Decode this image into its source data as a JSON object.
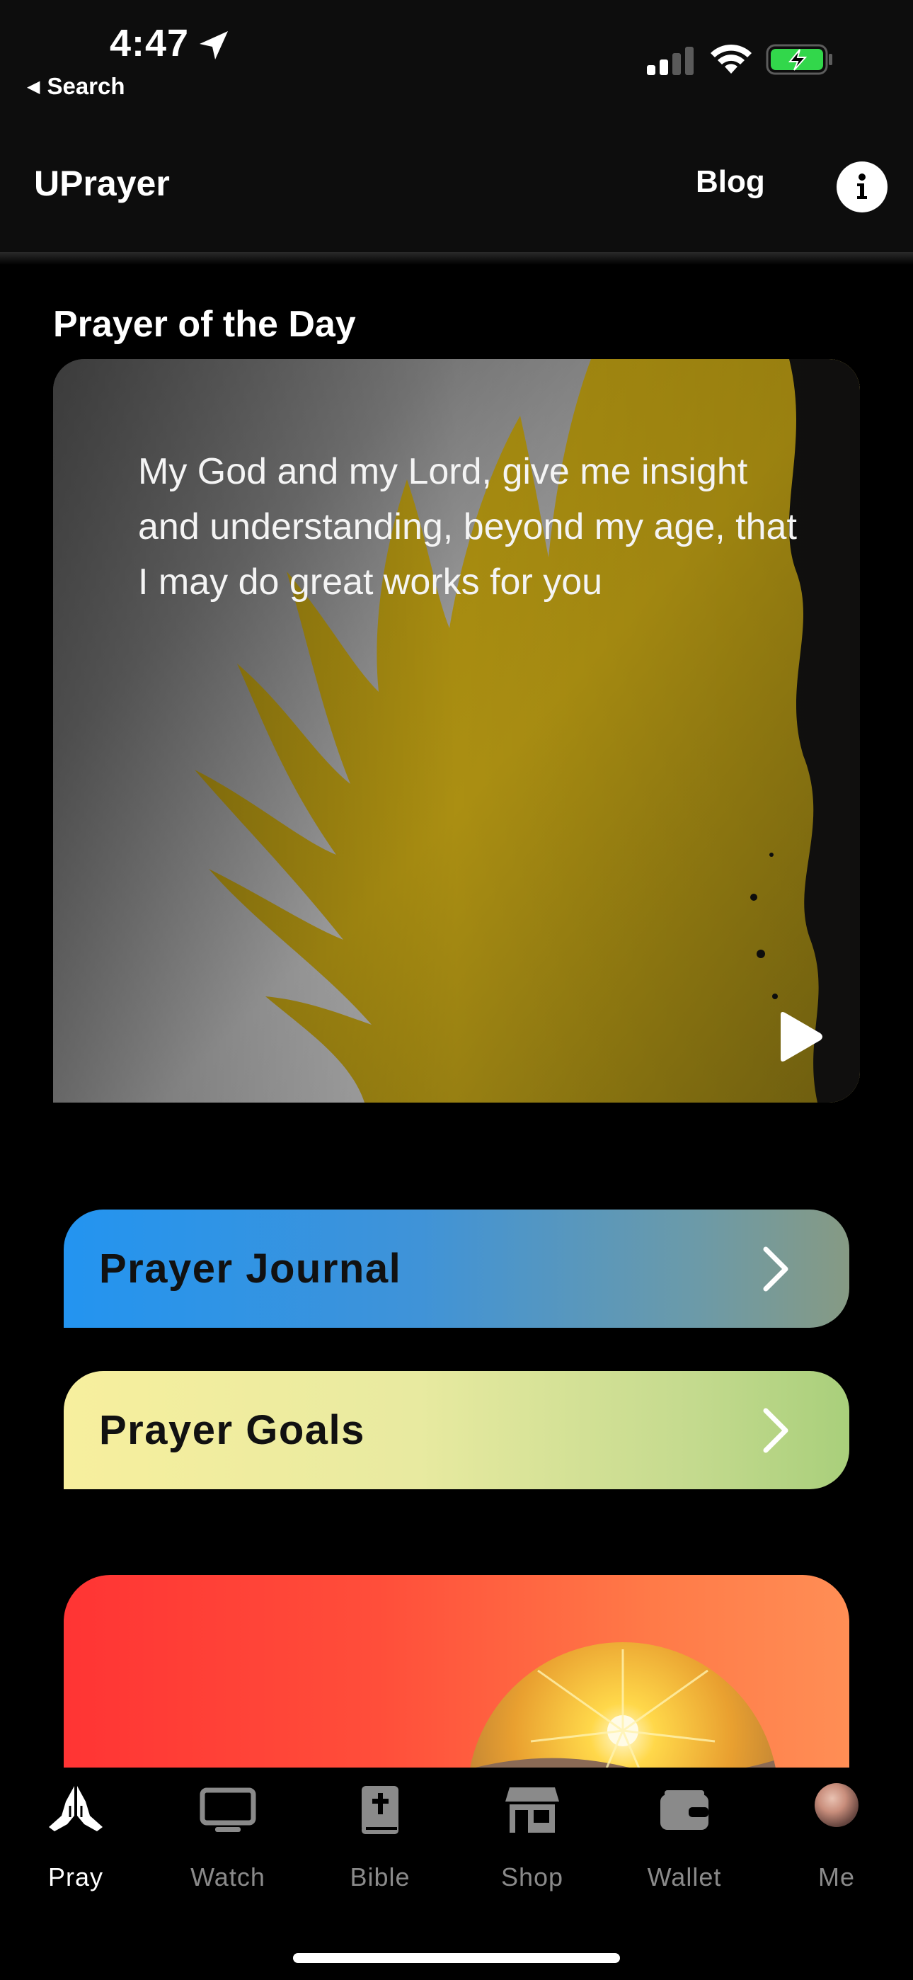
{
  "status_bar": {
    "time": "4:47",
    "back_label": "Search",
    "battery_color": "#32d74b"
  },
  "header": {
    "app_title": "UPrayer",
    "blog_label": "Blog",
    "info_icon": "info-icon"
  },
  "prayer_of_the_day": {
    "section_title": "Prayer of the Day",
    "text": "My God and my Lord,  give me insight and understanding, beyond my age, that I may do great works for you",
    "accent_color": "#d4b31a"
  },
  "links": {
    "journal_label": "Prayer Journal",
    "goals_label": "Prayer Goals"
  },
  "tabbar": {
    "tabs": [
      {
        "label": "Pray",
        "icon": "praying-hands-icon",
        "active": true
      },
      {
        "label": "Watch",
        "icon": "monitor-icon",
        "active": false
      },
      {
        "label": "Bible",
        "icon": "bible-icon",
        "active": false
      },
      {
        "label": "Shop",
        "icon": "store-icon",
        "active": false
      },
      {
        "label": "Wallet",
        "icon": "wallet-icon",
        "active": false
      },
      {
        "label": "Me",
        "icon": "avatar",
        "active": false
      }
    ]
  }
}
